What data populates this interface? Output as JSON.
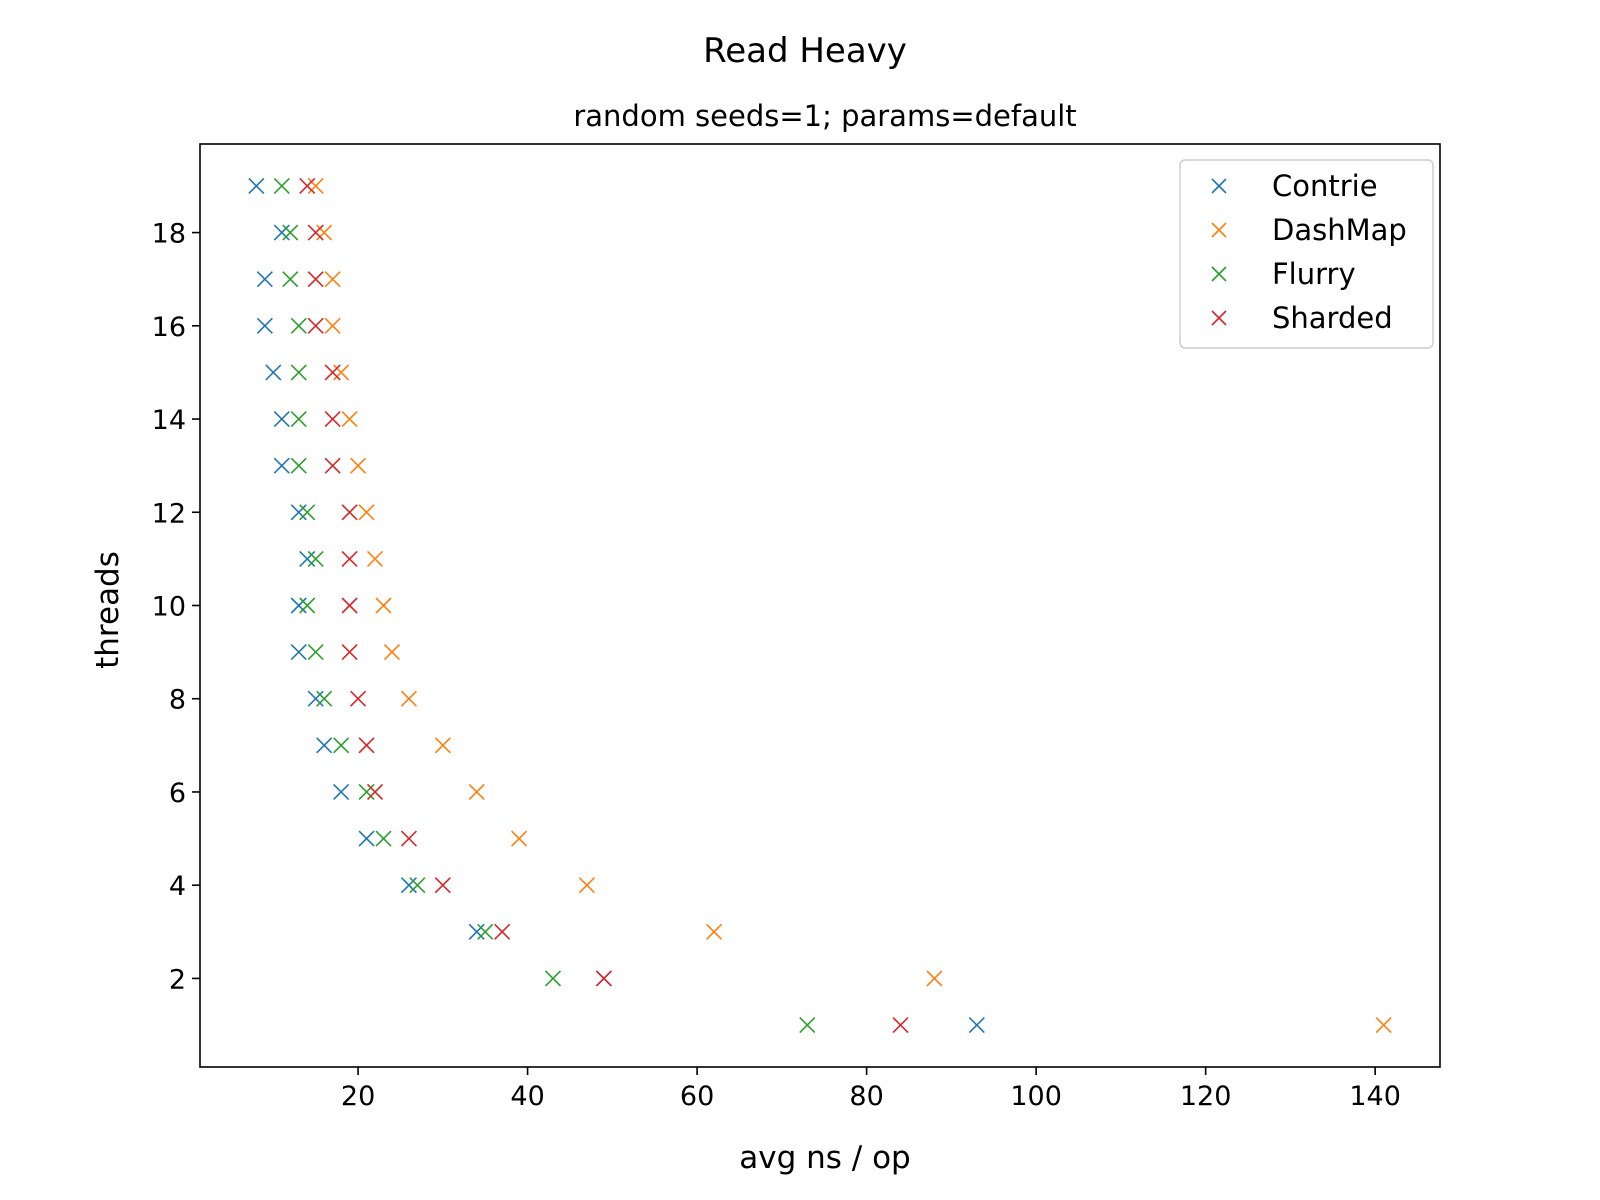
{
  "chart_data": {
    "type": "scatter",
    "title": "Read Heavy",
    "subtitle": "random seeds=1; params=default",
    "xlabel": "avg ns / op",
    "ylabel": "threads",
    "xlim": [
      1.35,
      147.65
    ],
    "ylim": [
      0.1,
      19.9
    ],
    "xticks": [
      20,
      40,
      60,
      80,
      100,
      120,
      140
    ],
    "yticks": [
      2,
      4,
      6,
      8,
      10,
      12,
      14,
      16,
      18
    ],
    "grid": false,
    "marker": "x",
    "legend_position": "top-right",
    "y": [
      19,
      18,
      17,
      16,
      15,
      14,
      13,
      12,
      11,
      10,
      9,
      8,
      7,
      6,
      5,
      4,
      3,
      2,
      1
    ],
    "series": [
      {
        "name": "Contrie",
        "color": "#1f77b4",
        "x": [
          8,
          11,
          9,
          9,
          10,
          11,
          11,
          13,
          14,
          13,
          13,
          15,
          16,
          18,
          21,
          26,
          34,
          49,
          93
        ]
      },
      {
        "name": "DashMap",
        "color": "#ff7f0e",
        "x": [
          15,
          16,
          17,
          17,
          18,
          19,
          20,
          21,
          22,
          23,
          24,
          26,
          30,
          34,
          39,
          47,
          62,
          88,
          141
        ]
      },
      {
        "name": "Flurry",
        "color": "#2ca02c",
        "x": [
          11,
          12,
          12,
          13,
          13,
          13,
          13,
          14,
          15,
          14,
          15,
          16,
          18,
          21,
          23,
          27,
          35,
          43,
          73
        ]
      },
      {
        "name": "Sharded",
        "color": "#d62728",
        "x": [
          14,
          15,
          15,
          15,
          17,
          17,
          17,
          19,
          19,
          19,
          19,
          20,
          21,
          22,
          26,
          30,
          37,
          49,
          84
        ]
      }
    ]
  }
}
